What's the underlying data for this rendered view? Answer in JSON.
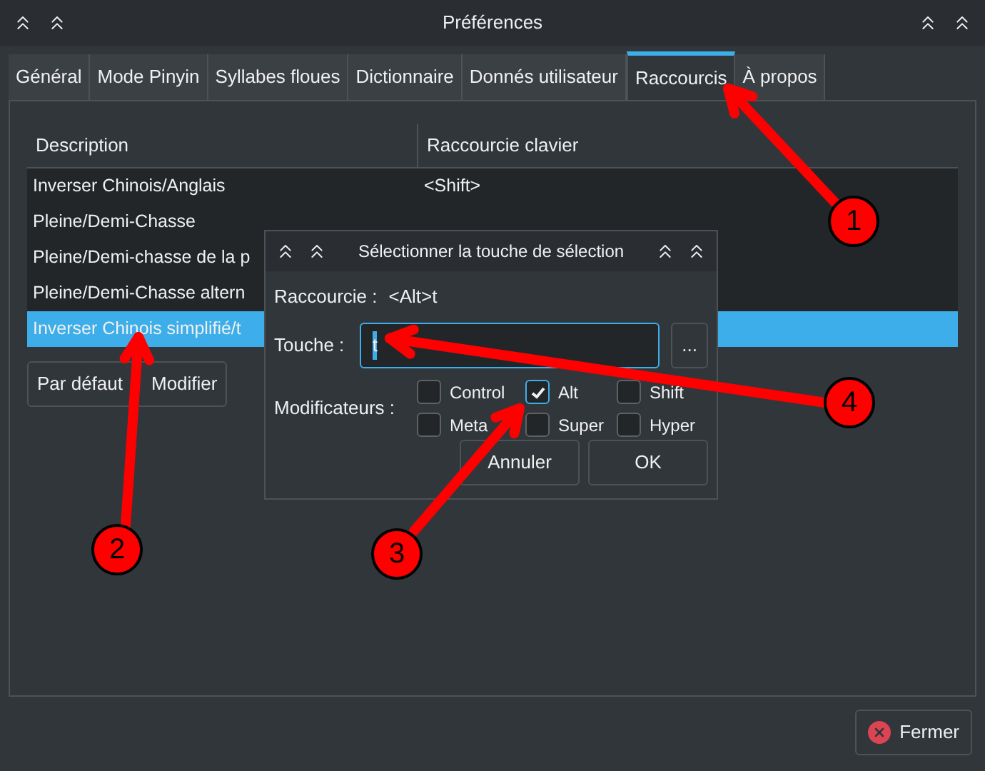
{
  "window": {
    "title": "Préférences"
  },
  "tabs": [
    {
      "label": "Général",
      "selected": false
    },
    {
      "label": "Mode Pinyin",
      "selected": false
    },
    {
      "label": "Syllabes floues",
      "selected": false
    },
    {
      "label": "Dictionnaire",
      "selected": false
    },
    {
      "label": "Donnés utilisateur",
      "selected": false
    },
    {
      "label": "Raccourcis",
      "selected": true
    },
    {
      "label": "À propos",
      "selected": false
    }
  ],
  "table": {
    "columns": [
      "Description",
      "Raccourcie clavier"
    ],
    "rows": [
      {
        "cells": [
          "Inverser Chinois/Anglais",
          "<Shift>"
        ],
        "selected": false
      },
      {
        "cells": [
          "Pleine/Demi-Chasse"
        ],
        "selected": false
      },
      {
        "cells": [
          "Pleine/Demi-chasse de la p"
        ],
        "selected": false
      },
      {
        "cells": [
          "Pleine/Demi-Chasse altern"
        ],
        "selected": false
      },
      {
        "cells": [
          "Inverser Chinois simplifié/t"
        ],
        "selected": true
      }
    ]
  },
  "buttons": [
    "Par défaut",
    "Modifier"
  ],
  "dialog": {
    "title": "Sélectionner la touche de sélection",
    "shortcut_label": "Raccourcie :",
    "shortcut_value": "<Alt>t",
    "key_label": "Touche :",
    "key_value": "t",
    "browse_button": "...",
    "modifiers_label": "Modificateurs :",
    "modifiers": [
      {
        "label": "Control",
        "checked": false
      },
      {
        "label": "Alt",
        "checked": true
      },
      {
        "label": "Shift",
        "checked": false
      },
      {
        "label": "Meta",
        "checked": false
      },
      {
        "label": "Super",
        "checked": false
      },
      {
        "label": "Hyper",
        "checked": false
      }
    ],
    "buttons": [
      "Annuler",
      "OK"
    ]
  },
  "close_button": "Fermer",
  "annotations": [
    {
      "label": "1"
    },
    {
      "label": "2"
    },
    {
      "label": "3"
    },
    {
      "label": "4"
    }
  ]
}
